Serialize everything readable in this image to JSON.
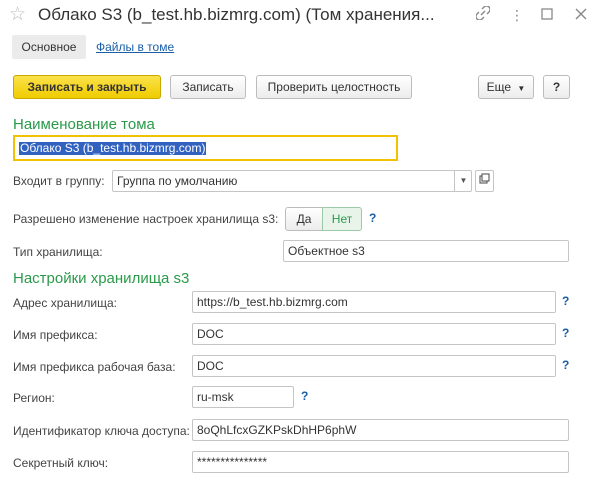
{
  "window": {
    "title": "Облако S3 (b_test.hb.bizmrg.com) (Том хранения...",
    "star_icon": "star-icon",
    "icons": [
      "link-icon",
      "more-icon",
      "maximize-icon",
      "close-icon"
    ]
  },
  "tabs": {
    "main": "Основное",
    "files": "Файлы в томе"
  },
  "toolbar": {
    "save_close": "Записать и закрыть",
    "save": "Записать",
    "check": "Проверить целостность",
    "more": "Еще",
    "help": "?"
  },
  "name_section": {
    "title": "Наименование тома",
    "value": "Облако S3 (b_test.hb.bizmrg.com)"
  },
  "group": {
    "label": "Входит в группу:",
    "value": "Группа по умолчанию"
  },
  "change_allowed": {
    "label": "Разрешено изменение настроек хранилища s3:",
    "yes": "Да",
    "no": "Нет",
    "selected": "Нет",
    "help": "?"
  },
  "storage_type": {
    "label": "Тип хранилища:",
    "value": "Объектное s3"
  },
  "settings_section": {
    "title": "Настройки хранилища s3"
  },
  "address": {
    "label": "Адрес хранилища:",
    "value": "https://b_test.hb.bizmrg.com",
    "help": "?"
  },
  "prefix": {
    "label": "Имя префикса:",
    "value": "DOC",
    "help": "?"
  },
  "prefix_work": {
    "label": "Имя префикса рабочая база:",
    "value": "DOC",
    "help": "?"
  },
  "region": {
    "label": "Регион:",
    "value": "ru-msk",
    "help": "?"
  },
  "access_key": {
    "label": "Идентификатор ключа доступа:",
    "value": "8oQhLfcxGZKPskDhHP6phW"
  },
  "secret_key": {
    "label": "Секретный ключ:",
    "value": "***************"
  },
  "colors": {
    "accent_green": "#2a9a4a",
    "primary_yellow": "#f0cc00",
    "link_blue": "#1a5ea8",
    "focus_border": "#f2c200",
    "selection_blue": "#3162c0"
  }
}
